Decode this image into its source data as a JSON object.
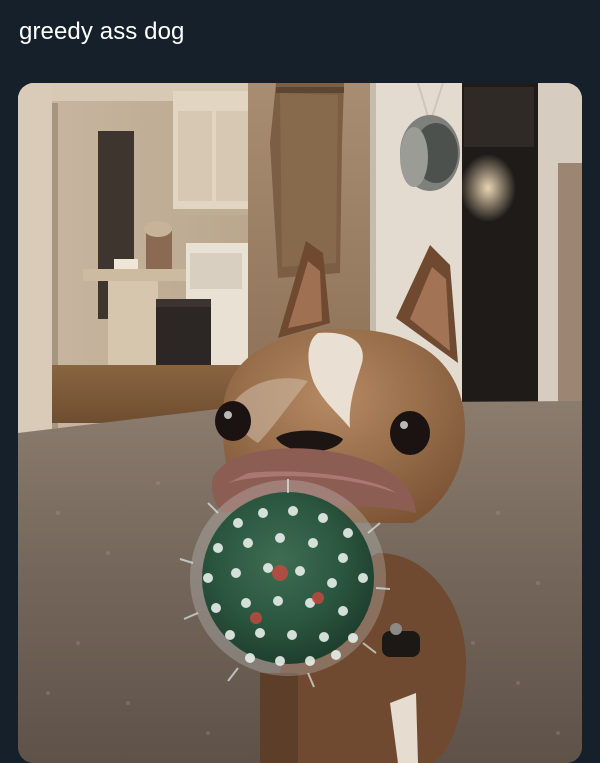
{
  "tweet": {
    "text": "greedy ass dog"
  },
  "media": {
    "subject_icon": "photo-dog-with-spiky-ball",
    "colors": {
      "background": "#15202b",
      "text": "#ffffff"
    }
  }
}
